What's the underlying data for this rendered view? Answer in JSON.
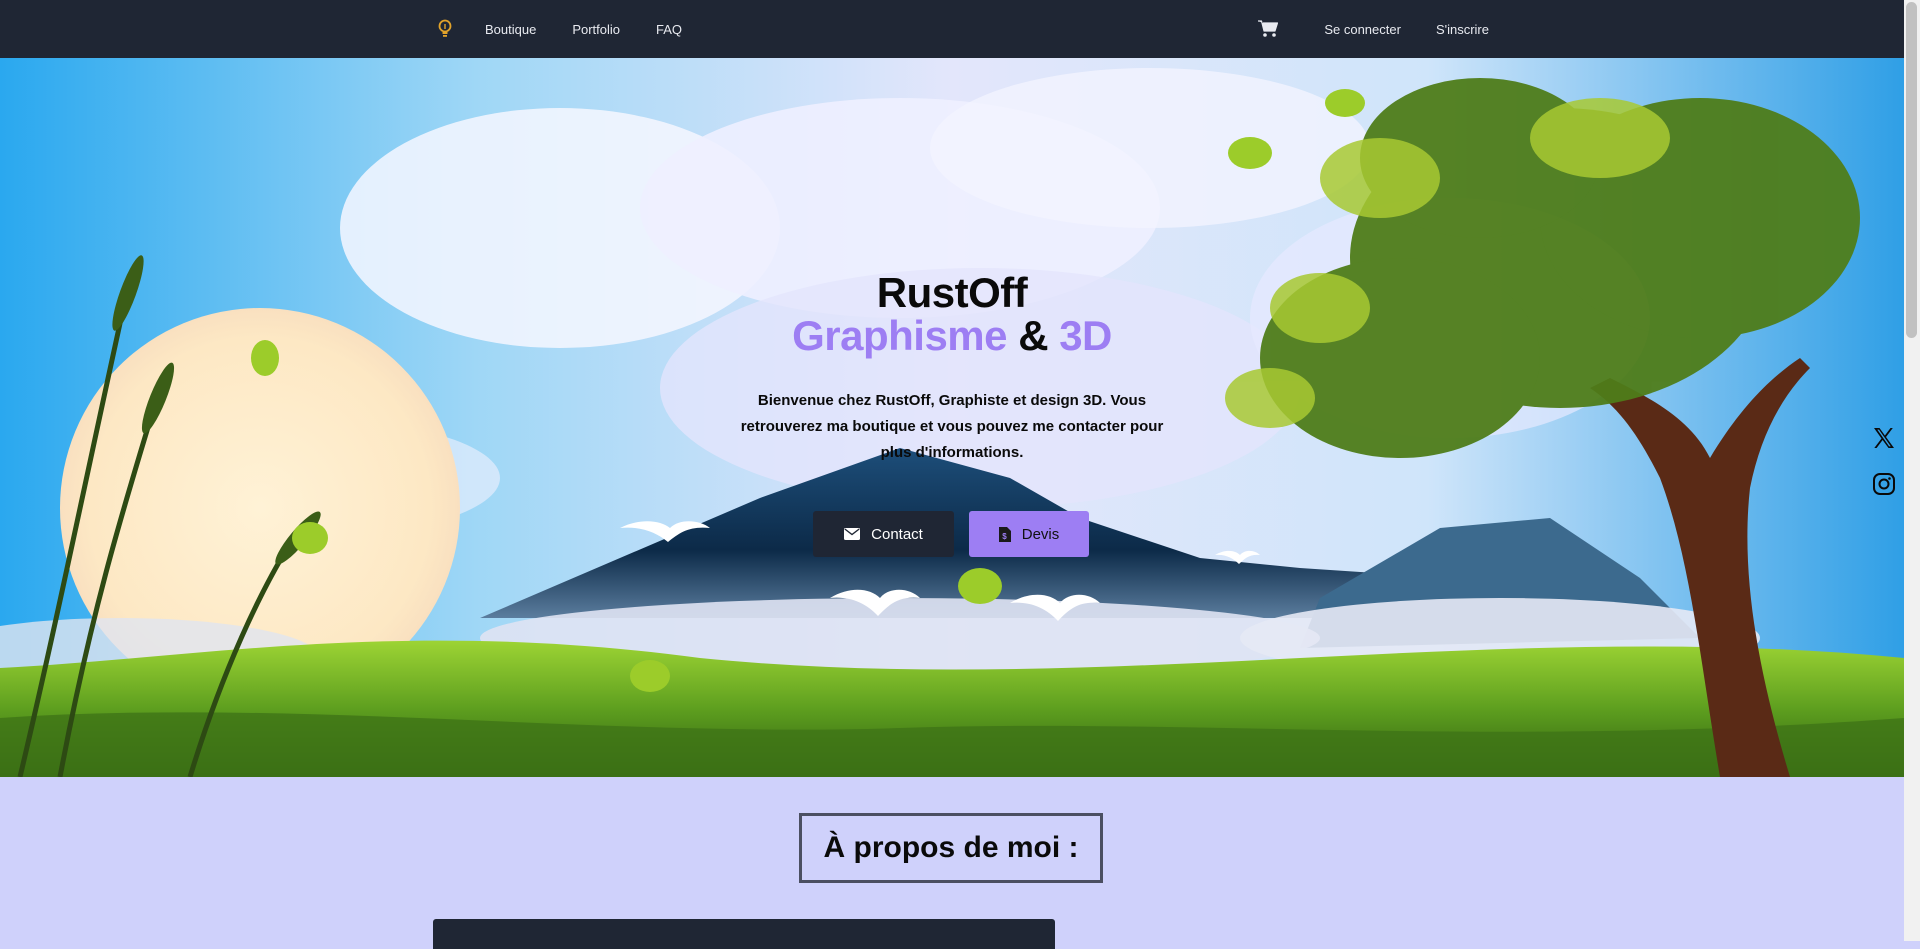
{
  "nav": {
    "links_left": [
      "Boutique",
      "Portfolio",
      "FAQ"
    ],
    "login": "Se connecter",
    "signup": "S'inscrire",
    "logo_icon": "lightbulb-icon",
    "cart_icon": "cart-icon"
  },
  "hero": {
    "title_line1": "RustOff",
    "title_word1": "Graphisme",
    "title_amp": "&",
    "title_word2": "3D",
    "description": "Bienvenue chez RustOff, Graphiste et design 3D. Vous retrouverez ma boutique et vous pouvez me contacter pour plus d'informations.",
    "contact_label": "Contact",
    "devis_label": "Devis",
    "accent_color": "#9d7ef3"
  },
  "social": {
    "x_icon": "x-twitter-icon",
    "instagram_icon": "instagram-icon"
  },
  "about": {
    "heading": "À propos de moi :"
  }
}
